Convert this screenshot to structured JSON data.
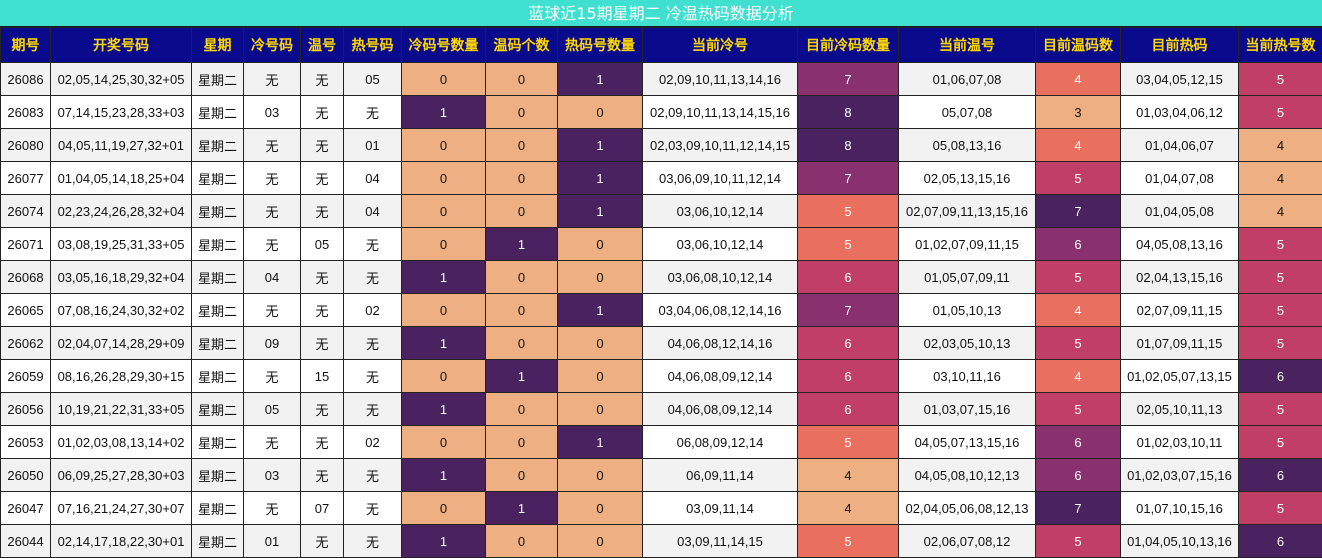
{
  "title": "蓝球近15期星期二 冷温热码数据分析",
  "headers": [
    "期号",
    "开奖号码",
    "星期",
    "冷号码",
    "温号",
    "热号码",
    "冷码号数量",
    "温码个数",
    "热码号数量",
    "当前冷号",
    "目前冷码数量",
    "当前温号",
    "目前温码数",
    "目前热码",
    "当前热号数"
  ],
  "colors": {
    "level_1": "#eeb082",
    "level_2": "#e9705e",
    "level_3": "#c13f67",
    "level_4": "#89306f",
    "level_5": "#4b2260",
    "header_bg": "#0a0a8c",
    "header_text": "#ffd700",
    "title_bg": "#40e0d0"
  },
  "rows": [
    {
      "issue": "26086",
      "numbers": "02,05,14,25,30,32+05",
      "weekday": "星期二",
      "cold": "无",
      "warm": "无",
      "hot": "05",
      "cold_count": "0",
      "warm_count": "0",
      "hot_count": "1",
      "cur_cold": "02,09,10,11,13,14,16",
      "cur_cold_count": "7",
      "cur_warm": "01,06,07,08",
      "cur_warm_count": "4",
      "cur_hot": "03,04,05,12,15",
      "cur_hot_count": "5"
    },
    {
      "issue": "26083",
      "numbers": "07,14,15,23,28,33+03",
      "weekday": "星期二",
      "cold": "03",
      "warm": "无",
      "hot": "无",
      "cold_count": "1",
      "warm_count": "0",
      "hot_count": "0",
      "cur_cold": "02,09,10,11,13,14,15,16",
      "cur_cold_count": "8",
      "cur_warm": "05,07,08",
      "cur_warm_count": "3",
      "cur_hot": "01,03,04,06,12",
      "cur_hot_count": "5"
    },
    {
      "issue": "26080",
      "numbers": "04,05,11,19,27,32+01",
      "weekday": "星期二",
      "cold": "无",
      "warm": "无",
      "hot": "01",
      "cold_count": "0",
      "warm_count": "0",
      "hot_count": "1",
      "cur_cold": "02,03,09,10,11,12,14,15",
      "cur_cold_count": "8",
      "cur_warm": "05,08,13,16",
      "cur_warm_count": "4",
      "cur_hot": "01,04,06,07",
      "cur_hot_count": "4"
    },
    {
      "issue": "26077",
      "numbers": "01,04,05,14,18,25+04",
      "weekday": "星期二",
      "cold": "无",
      "warm": "无",
      "hot": "04",
      "cold_count": "0",
      "warm_count": "0",
      "hot_count": "1",
      "cur_cold": "03,06,09,10,11,12,14",
      "cur_cold_count": "7",
      "cur_warm": "02,05,13,15,16",
      "cur_warm_count": "5",
      "cur_hot": "01,04,07,08",
      "cur_hot_count": "4"
    },
    {
      "issue": "26074",
      "numbers": "02,23,24,26,28,32+04",
      "weekday": "星期二",
      "cold": "无",
      "warm": "无",
      "hot": "04",
      "cold_count": "0",
      "warm_count": "0",
      "hot_count": "1",
      "cur_cold": "03,06,10,12,14",
      "cur_cold_count": "5",
      "cur_warm": "02,07,09,11,13,15,16",
      "cur_warm_count": "7",
      "cur_hot": "01,04,05,08",
      "cur_hot_count": "4"
    },
    {
      "issue": "26071",
      "numbers": "03,08,19,25,31,33+05",
      "weekday": "星期二",
      "cold": "无",
      "warm": "05",
      "hot": "无",
      "cold_count": "0",
      "warm_count": "1",
      "hot_count": "0",
      "cur_cold": "03,06,10,12,14",
      "cur_cold_count": "5",
      "cur_warm": "01,02,07,09,11,15",
      "cur_warm_count": "6",
      "cur_hot": "04,05,08,13,16",
      "cur_hot_count": "5"
    },
    {
      "issue": "26068",
      "numbers": "03,05,16,18,29,32+04",
      "weekday": "星期二",
      "cold": "04",
      "warm": "无",
      "hot": "无",
      "cold_count": "1",
      "warm_count": "0",
      "hot_count": "0",
      "cur_cold": "03,06,08,10,12,14",
      "cur_cold_count": "6",
      "cur_warm": "01,05,07,09,11",
      "cur_warm_count": "5",
      "cur_hot": "02,04,13,15,16",
      "cur_hot_count": "5"
    },
    {
      "issue": "26065",
      "numbers": "07,08,16,24,30,32+02",
      "weekday": "星期二",
      "cold": "无",
      "warm": "无",
      "hot": "02",
      "cold_count": "0",
      "warm_count": "0",
      "hot_count": "1",
      "cur_cold": "03,04,06,08,12,14,16",
      "cur_cold_count": "7",
      "cur_warm": "01,05,10,13",
      "cur_warm_count": "4",
      "cur_hot": "02,07,09,11,15",
      "cur_hot_count": "5"
    },
    {
      "issue": "26062",
      "numbers": "02,04,07,14,28,29+09",
      "weekday": "星期二",
      "cold": "09",
      "warm": "无",
      "hot": "无",
      "cold_count": "1",
      "warm_count": "0",
      "hot_count": "0",
      "cur_cold": "04,06,08,12,14,16",
      "cur_cold_count": "6",
      "cur_warm": "02,03,05,10,13",
      "cur_warm_count": "5",
      "cur_hot": "01,07,09,11,15",
      "cur_hot_count": "5"
    },
    {
      "issue": "26059",
      "numbers": "08,16,26,28,29,30+15",
      "weekday": "星期二",
      "cold": "无",
      "warm": "15",
      "hot": "无",
      "cold_count": "0",
      "warm_count": "1",
      "hot_count": "0",
      "cur_cold": "04,06,08,09,12,14",
      "cur_cold_count": "6",
      "cur_warm": "03,10,11,16",
      "cur_warm_count": "4",
      "cur_hot": "01,02,05,07,13,15",
      "cur_hot_count": "6"
    },
    {
      "issue": "26056",
      "numbers": "10,19,21,22,31,33+05",
      "weekday": "星期二",
      "cold": "05",
      "warm": "无",
      "hot": "无",
      "cold_count": "1",
      "warm_count": "0",
      "hot_count": "0",
      "cur_cold": "04,06,08,09,12,14",
      "cur_cold_count": "6",
      "cur_warm": "01,03,07,15,16",
      "cur_warm_count": "5",
      "cur_hot": "02,05,10,11,13",
      "cur_hot_count": "5"
    },
    {
      "issue": "26053",
      "numbers": "01,02,03,08,13,14+02",
      "weekday": "星期二",
      "cold": "无",
      "warm": "无",
      "hot": "02",
      "cold_count": "0",
      "warm_count": "0",
      "hot_count": "1",
      "cur_cold": "06,08,09,12,14",
      "cur_cold_count": "5",
      "cur_warm": "04,05,07,13,15,16",
      "cur_warm_count": "6",
      "cur_hot": "01,02,03,10,11",
      "cur_hot_count": "5"
    },
    {
      "issue": "26050",
      "numbers": "06,09,25,27,28,30+03",
      "weekday": "星期二",
      "cold": "03",
      "warm": "无",
      "hot": "无",
      "cold_count": "1",
      "warm_count": "0",
      "hot_count": "0",
      "cur_cold": "06,09,11,14",
      "cur_cold_count": "4",
      "cur_warm": "04,05,08,10,12,13",
      "cur_warm_count": "6",
      "cur_hot": "01,02,03,07,15,16",
      "cur_hot_count": "6"
    },
    {
      "issue": "26047",
      "numbers": "07,16,21,24,27,30+07",
      "weekday": "星期二",
      "cold": "无",
      "warm": "07",
      "hot": "无",
      "cold_count": "0",
      "warm_count": "1",
      "hot_count": "0",
      "cur_cold": "03,09,11,14",
      "cur_cold_count": "4",
      "cur_warm": "02,04,05,06,08,12,13",
      "cur_warm_count": "7",
      "cur_hot": "01,07,10,15,16",
      "cur_hot_count": "5"
    },
    {
      "issue": "26044",
      "numbers": "02,14,17,18,22,30+01",
      "weekday": "星期二",
      "cold": "01",
      "warm": "无",
      "hot": "无",
      "cold_count": "1",
      "warm_count": "0",
      "hot_count": "0",
      "cur_cold": "03,09,11,14,15",
      "cur_cold_count": "5",
      "cur_warm": "02,06,07,08,12",
      "cur_warm_count": "5",
      "cur_hot": "01,04,05,10,13,16",
      "cur_hot_count": "6"
    }
  ]
}
